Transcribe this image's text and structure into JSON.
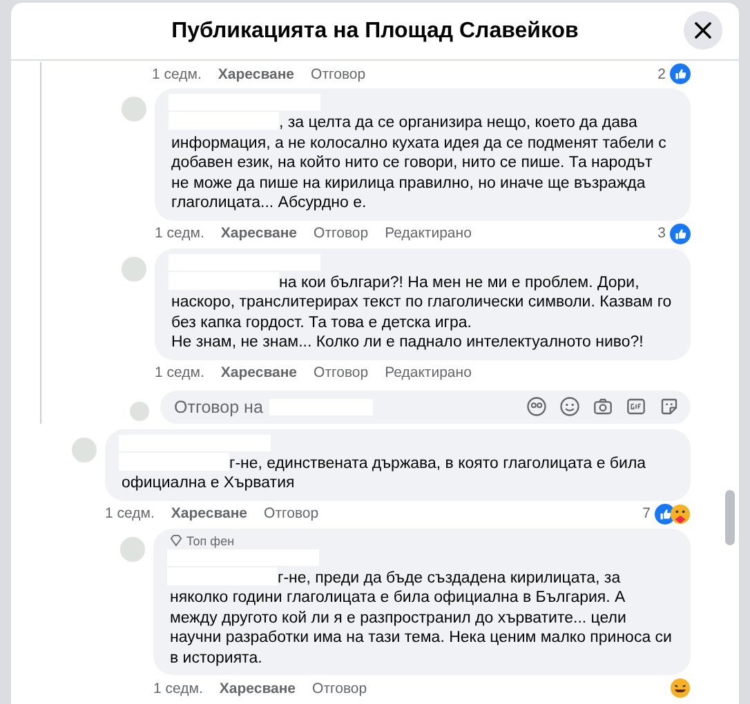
{
  "dialog": {
    "title": "Публикацията на Площад Славейков"
  },
  "top_actions": {
    "time": "1 седм.",
    "like": "Харесване",
    "reply": "Отговор",
    "reaction_count": "2"
  },
  "thread_a": {
    "replies": [
      {
        "text": ", за целта да се организира нещо, което да дава информация, а не колосално кухата идея да се подменят табели с добавен език, на който нито се говори, нито се пише. Та народът не може да пише на кирилица правилно, но иначе ще възражда глаголицата... Абсурдно е.",
        "time": "1 седм.",
        "like": "Харесване",
        "reply": "Отговор",
        "edited": "Редактирано",
        "reaction_count": "3"
      },
      {
        "text": "на кои българи?! На мен не ми е проблем. Дори, наскоро, транслитерирах текст по глаголически символи. Казвам го без капка гордост. Та това е детска игра.\nНе знам, не знам... Колко ли е паднало интелектуалното ниво?!",
        "time": "1 седм.",
        "like": "Харесване",
        "reply": "Отговор",
        "edited": "Редактирано"
      }
    ],
    "reply_field": {
      "placeholder": "Отговор на"
    }
  },
  "thread_b": {
    "comment": {
      "text": "г-не, единствената държава, в която глаголицата е била официална е Хърватия",
      "time": "1 седм.",
      "like": "Харесване",
      "reply": "Отговор",
      "reaction_count": "7"
    },
    "replies": [
      {
        "badge": "Топ фен",
        "text": "г-не, преди да бъде създадена кирилицата, за няколко години глаголицата е била официална в България. А между другото кой ли я е разпространил до хърватите... цели научни разработки има на тази тема. Нека ценим малко приноса си в историята.",
        "time": "1 седм.",
        "like": "Харесване",
        "reply": "Отговор"
      }
    ]
  }
}
